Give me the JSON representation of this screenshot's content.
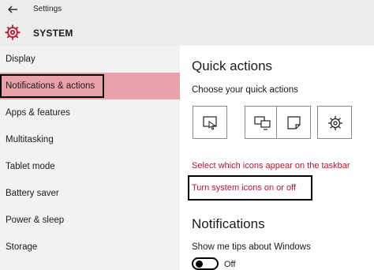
{
  "window": {
    "title": "Settings"
  },
  "header": {
    "section": "SYSTEM"
  },
  "sidebar": {
    "items": [
      {
        "label": "Display"
      },
      {
        "label": "Notifications & actions",
        "selected": true
      },
      {
        "label": "Apps & features"
      },
      {
        "label": "Multitasking"
      },
      {
        "label": "Tablet mode"
      },
      {
        "label": "Battery saver"
      },
      {
        "label": "Power & sleep"
      },
      {
        "label": "Storage"
      }
    ]
  },
  "main": {
    "quick_actions": {
      "heading": "Quick actions",
      "subtitle": "Choose your quick actions",
      "tiles": [
        "tablet-mode-icon",
        "project-icon",
        "note-icon",
        "settings-icon"
      ]
    },
    "links": {
      "select_icons": "Select which icons appear on the taskbar",
      "system_icons": "Turn system icons on or off"
    },
    "notifications": {
      "heading": "Notifications",
      "tips_label": "Show me tips about Windows",
      "tips_state": "Off"
    }
  },
  "colors": {
    "accent": "#c8102e",
    "selected_bg": "#e8a2a9"
  }
}
